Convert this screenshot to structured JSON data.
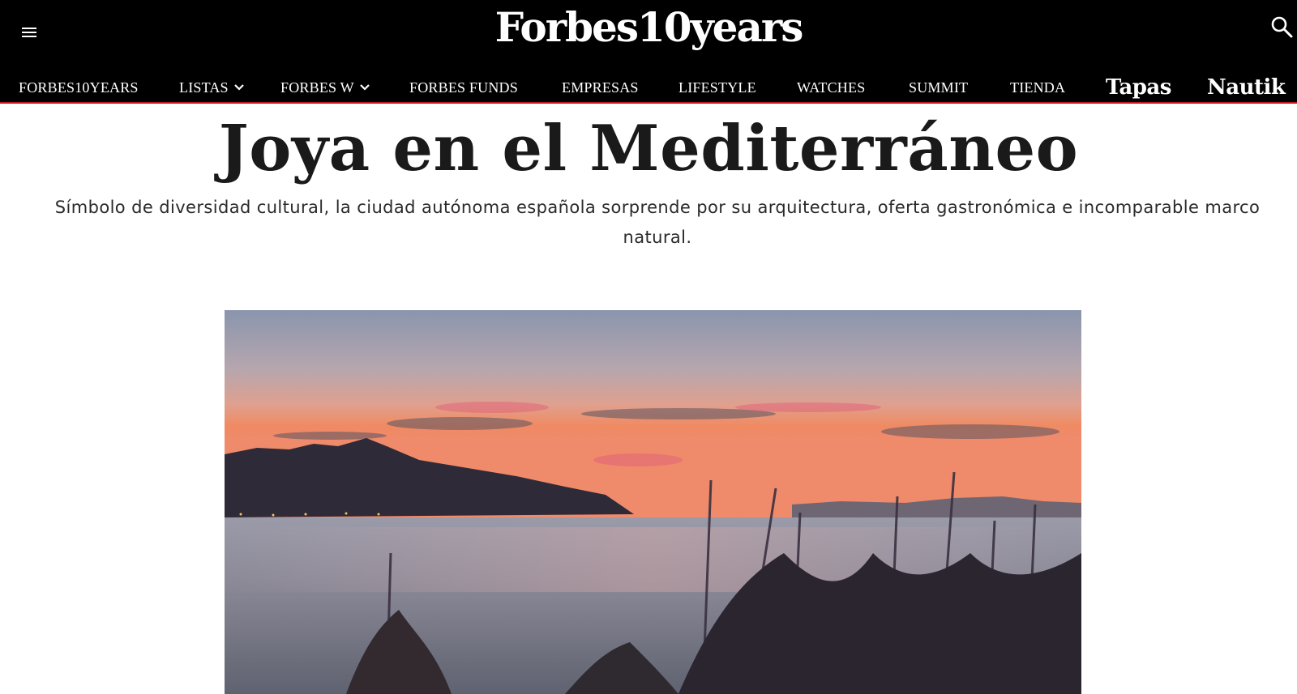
{
  "header": {
    "logo": "Forbes10years",
    "menu_icon": "hamburger-menu-icon",
    "search_icon": "search-icon"
  },
  "nav": {
    "items": [
      {
        "label": "FORBES10YEARS"
      },
      {
        "label": "LISTAS",
        "icon": "chevron-down-icon"
      },
      {
        "label": "FORBES W",
        "icon": "chevron-down-icon"
      },
      {
        "label": "FORBES FUNDS"
      },
      {
        "label": "EMPRESAS"
      },
      {
        "label": "LIFESTYLE"
      },
      {
        "label": "WATCHES"
      },
      {
        "label": "SUMMIT"
      },
      {
        "label": "TIENDA"
      },
      {
        "label": "Tapas"
      },
      {
        "label": "Nautik"
      }
    ]
  },
  "article": {
    "title": "Joya en el Mediterráneo",
    "subtitle": "Símbolo de diversidad cultural, la ciudad autónoma española sorprende por su arquitectura, oferta gastronómica e incomparable marco natural."
  },
  "colors": {
    "header_bg": "#000000",
    "nav_accent_line": "#c4161c",
    "text": "#1a1a1a"
  }
}
